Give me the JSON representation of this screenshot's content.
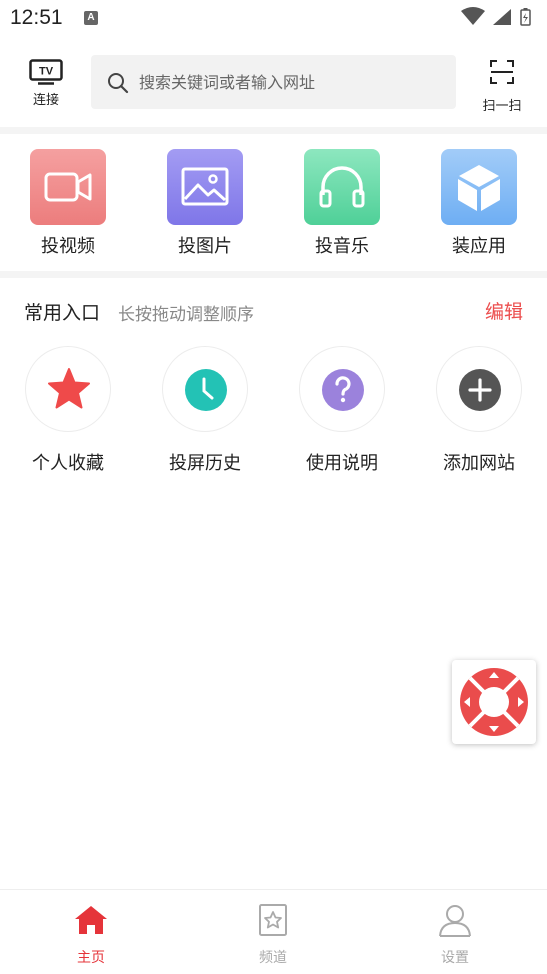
{
  "status_bar": {
    "time": "12:51",
    "notification_letter": "A"
  },
  "header": {
    "connect_label": "连接",
    "tv_text": "TV",
    "search_placeholder": "搜索关键词或者输入网址",
    "scan_label": "扫一扫"
  },
  "features": [
    {
      "label": "投视频",
      "icon": "video-camera-icon",
      "color": "#f08c8c"
    },
    {
      "label": "投图片",
      "icon": "image-icon",
      "color": "#8f86ee"
    },
    {
      "label": "投音乐",
      "icon": "headphones-icon",
      "color": "#63d9a6"
    },
    {
      "label": "装应用",
      "icon": "cube-icon",
      "color": "#7fb9f5"
    }
  ],
  "common": {
    "title": "常用入口",
    "hint": "长按拖动调整顺序",
    "edit_label": "编辑",
    "entries": [
      {
        "label": "个人收藏",
        "icon": "star-icon",
        "color": "#ef4a4a"
      },
      {
        "label": "投屏历史",
        "icon": "clock-icon",
        "color": "#23c2b5"
      },
      {
        "label": "使用说明",
        "icon": "question-icon",
        "color": "#9b82dc"
      },
      {
        "label": "添加网站",
        "icon": "plus-icon",
        "color": "#555555"
      }
    ]
  },
  "bottom_nav": {
    "items": [
      {
        "label": "主页",
        "icon": "home-icon",
        "active": true
      },
      {
        "label": "频道",
        "icon": "channel-icon",
        "active": false
      },
      {
        "label": "设置",
        "icon": "person-icon",
        "active": false
      }
    ],
    "active_color": "#e5343a",
    "inactive_color": "#aaaaaa"
  },
  "remote": {
    "icon": "remote-control-icon",
    "color": "#ea4c4c"
  }
}
